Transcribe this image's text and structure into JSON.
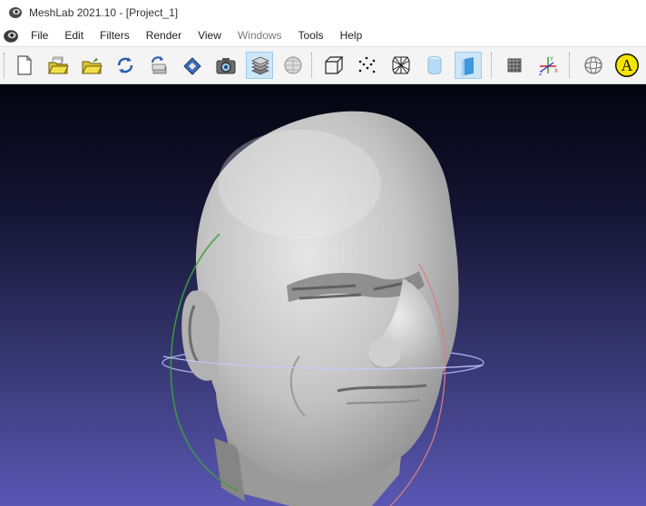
{
  "window": {
    "title": "MeshLab 2021.10 - [Project_1]"
  },
  "menu": {
    "items": [
      {
        "label": "File",
        "disabled": false
      },
      {
        "label": "Edit",
        "disabled": false
      },
      {
        "label": "Filters",
        "disabled": false
      },
      {
        "label": "Render",
        "disabled": false
      },
      {
        "label": "View",
        "disabled": false
      },
      {
        "label": "Windows",
        "disabled": true
      },
      {
        "label": "Tools",
        "disabled": false
      },
      {
        "label": "Help",
        "disabled": false
      }
    ]
  },
  "toolbar": {
    "buttons": [
      {
        "icon": "new-project-icon",
        "active": false
      },
      {
        "icon": "open-project-icon",
        "active": false
      },
      {
        "icon": "import-mesh-icon",
        "active": false
      },
      {
        "icon": "reload-icon",
        "active": false
      },
      {
        "icon": "reload-all-icon",
        "active": false
      },
      {
        "icon": "save-icon",
        "active": false
      },
      {
        "icon": "snapshot-icon",
        "active": false
      },
      {
        "icon": "layers-icon",
        "active": true
      },
      {
        "icon": "raster-icon",
        "active": false
      },
      {
        "icon": "bounding-box-icon",
        "active": false
      },
      {
        "icon": "points-icon",
        "active": false
      },
      {
        "icon": "wireframe-icon",
        "active": false
      },
      {
        "icon": "flat-icon",
        "active": false
      },
      {
        "icon": "smooth-icon",
        "active": true
      },
      {
        "icon": "decorate-icon",
        "active": false
      },
      {
        "icon": "axes-icon",
        "active": false
      },
      {
        "icon": "trackball-icon",
        "active": false
      },
      {
        "icon": "annotation-icon",
        "active": false
      }
    ],
    "annotation_label": "A",
    "axes_labels": {
      "x": "X",
      "y": "Y",
      "z": "Z"
    }
  },
  "colors": {
    "viewport_top": "#040410",
    "viewport_bottom": "#5957b3",
    "active_button": "#cde6f7",
    "mesh": "#c8c8c8"
  }
}
